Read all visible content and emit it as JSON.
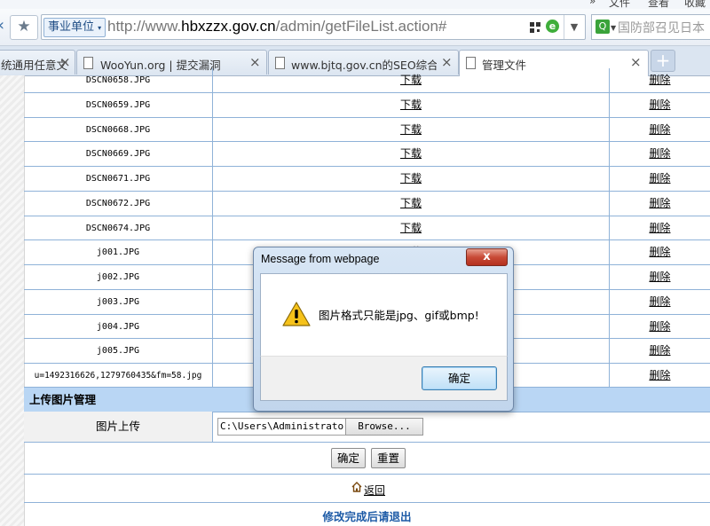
{
  "menu": {
    "items": [
      "文件",
      "查看",
      "收藏"
    ]
  },
  "toolbar": {
    "back": "«",
    "favorite": "★",
    "zone_label": "事业单位",
    "url_prefix": "http://www.",
    "url_domain": "hbxzzx.gov.cn",
    "url_path": "/admin/getFileList.action#",
    "search_placeholder": "国防部召见日本"
  },
  "tabs": [
    {
      "title": "统通用任意文",
      "active": false
    },
    {
      "title": "WooYun.org | 提交漏洞",
      "active": false
    },
    {
      "title": "www.bjtq.gov.cn的SEO综合查",
      "active": false
    },
    {
      "title": "管理文件",
      "active": true
    }
  ],
  "new_tab": "+",
  "file_list": {
    "download_label": "下载",
    "delete_label": "删除",
    "rows": [
      "DSCN0658.JPG",
      "DSCN0659.JPG",
      "DSCN0668.JPG",
      "DSCN0669.JPG",
      "DSCN0671.JPG",
      "DSCN0672.JPG",
      "DSCN0674.JPG",
      "j001.JPG",
      "j002.JPG",
      "j003.JPG",
      "j004.JPG",
      "j005.JPG",
      "u=1492316626,1279760435&fm=58.jpg"
    ]
  },
  "upload": {
    "section_title": "上传图片管理",
    "label": "图片上传",
    "file_value": "C:\\Users\\Administrator",
    "browse_label": "Browse...",
    "confirm_label": "确定",
    "reset_label": "重置",
    "back_label": "返回",
    "exit_note": "修改完成后请退出"
  },
  "dialog": {
    "title": "Message from webpage",
    "close": "x",
    "message": "图片格式只能是jpg、gif或bmp!",
    "ok_label": "确定"
  }
}
